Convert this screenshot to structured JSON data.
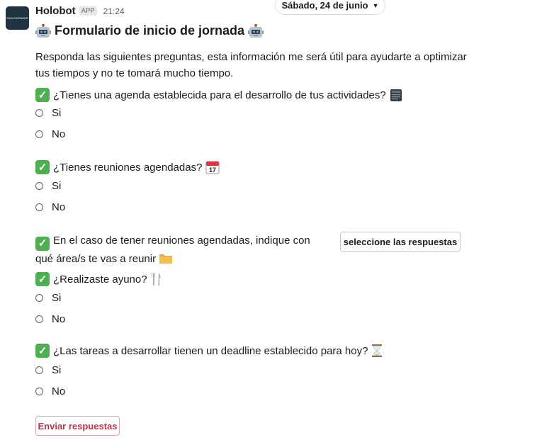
{
  "date_divider": {
    "label": "Sábado, 24 de junio",
    "icon": "chevron-down-icon"
  },
  "message": {
    "avatar_text": "HOLOCRUCE",
    "sender": "Holobot",
    "badge": "APP",
    "time": "21:24",
    "title": "Formulario de inicio de jornada",
    "intro": "Responda las siguientes preguntas, esta información me será útil para ayudarte a optimizar tus tiempos y no te tomará mucho tiempo."
  },
  "questions": [
    {
      "text": "¿Tienes una agenda establecida para el desarrollo de tus actividades?",
      "emoji_icon": "notebook-icon",
      "options": [
        "Si",
        "No"
      ]
    },
    {
      "text": "¿Tienes reuniones agendadas?",
      "emoji_icon": "calendar-icon",
      "options": [
        "Si",
        "No"
      ]
    },
    {
      "text": "En el caso de tener reuniones agendadas, indique con qué área/s te vas a reunir",
      "emoji_icon": "folder-icon",
      "button_label": "seleccione las respuestas"
    },
    {
      "text": "¿Realizaste ayuno?",
      "emoji_icon": "fork-knife-icon",
      "options": [
        "Si",
        "No"
      ]
    },
    {
      "text": "¿Las tareas a desarrollar tienen un deadline establecido para hoy?",
      "emoji_icon": "hourglass-icon",
      "options": [
        "Si",
        "No"
      ]
    }
  ],
  "submit_label": "Enviar respuestas",
  "colors": {
    "check_green": "#4caf50",
    "submit_text": "#c0324d",
    "avatar_bg": "#1f3440"
  }
}
